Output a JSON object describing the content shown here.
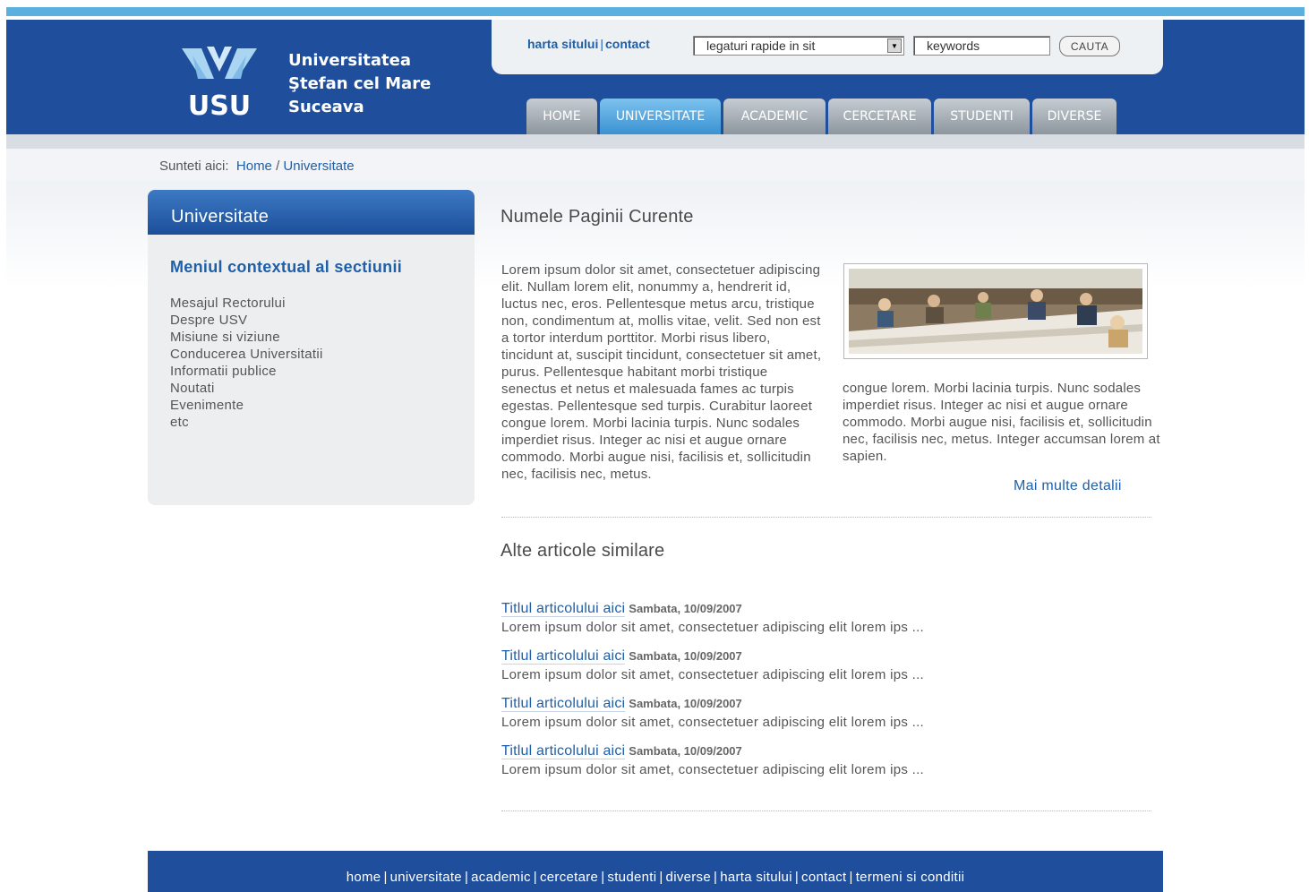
{
  "header": {
    "logo_mark": "USU",
    "university_lines": [
      "Universitatea",
      "Ştefan cel Mare",
      "Suceava"
    ],
    "util_links": [
      "harta sitului",
      "contact"
    ],
    "quick_links_select": "legaturi rapide in sit",
    "keywords_input": "keywords",
    "search_button": "CAUTA",
    "tabs": [
      {
        "label": "HOME",
        "active": false
      },
      {
        "label": "UNIVERSITATE",
        "active": true
      },
      {
        "label": "ACADEMIC",
        "active": false
      },
      {
        "label": "CERCETARE",
        "active": false
      },
      {
        "label": "STUDENTI",
        "active": false
      },
      {
        "label": "DIVERSE",
        "active": false
      }
    ]
  },
  "breadcrumb": {
    "prefix": "Sunteti aici:",
    "items": [
      "Home",
      "Universitate"
    ],
    "separator": "/"
  },
  "sidebar": {
    "title": "Universitate",
    "context_title": "Meniul contextual al sectiunii",
    "items": [
      "Mesajul Rectorului",
      "Despre USV",
      "Misiune si viziune",
      "Conducerea Universitatii",
      "Informatii publice",
      "Noutati",
      "Evenimente",
      "etc"
    ]
  },
  "main": {
    "page_title": "Numele Paginii Curente",
    "body_left": "Lorem ipsum dolor sit amet, consectetuer adipiscing elit. Nullam lorem elit, nonummy a, hendrerit id, luctus nec, eros. Pellentesque metus arcu, tristique non, condimentum at, mollis vitae, velit. Sed non est a tortor interdum porttitor. Morbi risus libero, tincidunt at, suscipit tincidunt, consectetuer sit amet, purus. Pellentesque habitant morbi tristique senectus et netus et malesuada fames ac turpis egestas. Pellentesque sed turpis. Curabitur laoreet congue lorem. Morbi lacinia turpis. Nunc sodales imperdiet risus. Integer ac nisi et augue ornare commodo. Morbi augue nisi, facilisis et, sollicitudin nec, facilisis nec, metus.",
    "body_right": "congue lorem. Morbi lacinia turpis. Nunc sodales imperdiet risus. Integer ac nisi et augue ornare commodo. Morbi augue nisi, facilisis et, sollicitudin nec, facilisis nec, metus. Integer accumsan lorem at sapien.",
    "more_link": "Mai multe detalii",
    "similar_title": "Alte articole similare",
    "articles": [
      {
        "title": "Titlul articolului aici",
        "date": "Sambata, 10/09/2007",
        "summary": "Lorem ipsum dolor sit amet, consectetuer adipiscing elit lorem ips ..."
      },
      {
        "title": "Titlul articolului aici",
        "date": "Sambata, 10/09/2007",
        "summary": "Lorem ipsum dolor sit amet, consectetuer adipiscing elit lorem ips ..."
      },
      {
        "title": "Titlul articolului aici",
        "date": "Sambata, 10/09/2007",
        "summary": "Lorem ipsum dolor sit amet, consectetuer adipiscing elit lorem ips ..."
      },
      {
        "title": "Titlul articolului aici",
        "date": "Sambata, 10/09/2007",
        "summary": "Lorem ipsum dolor sit amet, consectetuer adipiscing elit lorem ips ..."
      }
    ]
  },
  "footer": {
    "links": [
      "home",
      "universitate",
      "academic",
      "cercetare",
      "studenti",
      "diverse",
      "harta sitului",
      "contact",
      "termeni si conditii"
    ]
  },
  "colors": {
    "brand_blue": "#1f4f9c",
    "link_blue": "#1f5fa8",
    "accent_sky": "#5cb0e0",
    "active_tab": "#3a92d2"
  }
}
